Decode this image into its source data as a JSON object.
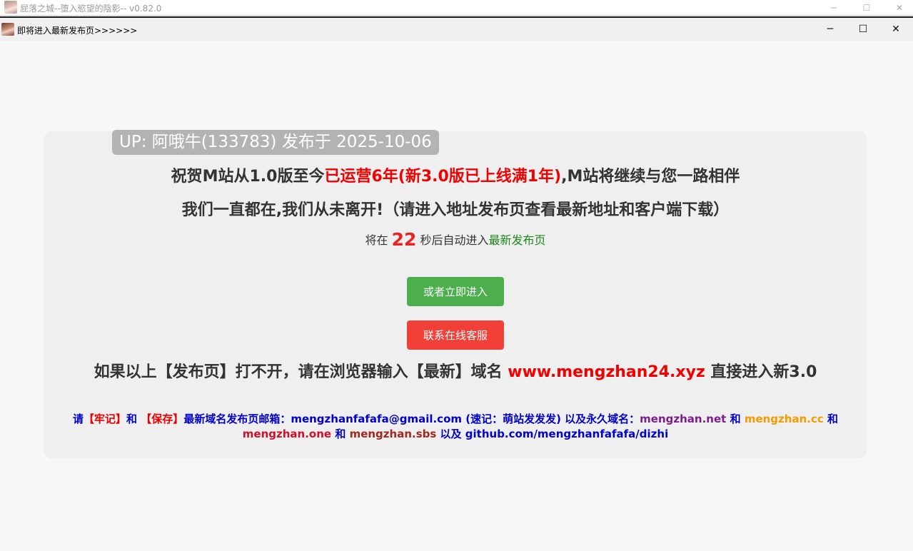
{
  "parent_window": {
    "title": "屁落之城--堕入慾望的陰影-- v0.82.0",
    "controls": {
      "minimize": "─",
      "maximize": "☐",
      "close": "✕"
    }
  },
  "dialog": {
    "title": "即将进入最新发布页>>>>>>",
    "controls": {
      "minimize": "─",
      "maximize": "☐",
      "close": "✕"
    }
  },
  "card": {
    "badge": "UP: 阿哦牛(133783) 发布于 2025-10-06",
    "line1": {
      "prefix": "祝贺M站从1.0版至今",
      "highlight": "已运营6年(新3.0版已上线满1年)",
      "suffix": ",M站将继续与您一路相伴"
    },
    "line2": "我们一直都在,我们从未离开!（请进入地址发布页查看最新地址和客户端下载）",
    "countdown": {
      "prefix": "将在",
      "seconds": "22",
      "middle": "秒后自动进入",
      "link": "最新发布页"
    },
    "enter_button": "或者立即进入",
    "support_button": "联系在线客服",
    "domain_note": {
      "prefix": "如果以上【发布页】打不开，请在浏览器输入【最新】域名",
      "domain": "www.mengzhan24.xyz",
      "suffix": "直接进入新3.0"
    },
    "remember": {
      "p1": "请",
      "remember": "【牢记】",
      "p2": "和",
      "save": "【保存】",
      "p3": "最新域名发布页邮箱：",
      "email": "mengzhanfafafa@gmail.com",
      "p4": "(速记：萌站发发发) 以及永久域名：",
      "d1": "mengzhan.net",
      "and1": "和",
      "d2": "mengzhan.cc",
      "and2": "和",
      "d3": "mengzhan.one",
      "and3": "和",
      "d4": "mengzhan.sbs",
      "p5": "以及",
      "github": "github.com/mengzhanfafafa/dizhi"
    }
  }
}
